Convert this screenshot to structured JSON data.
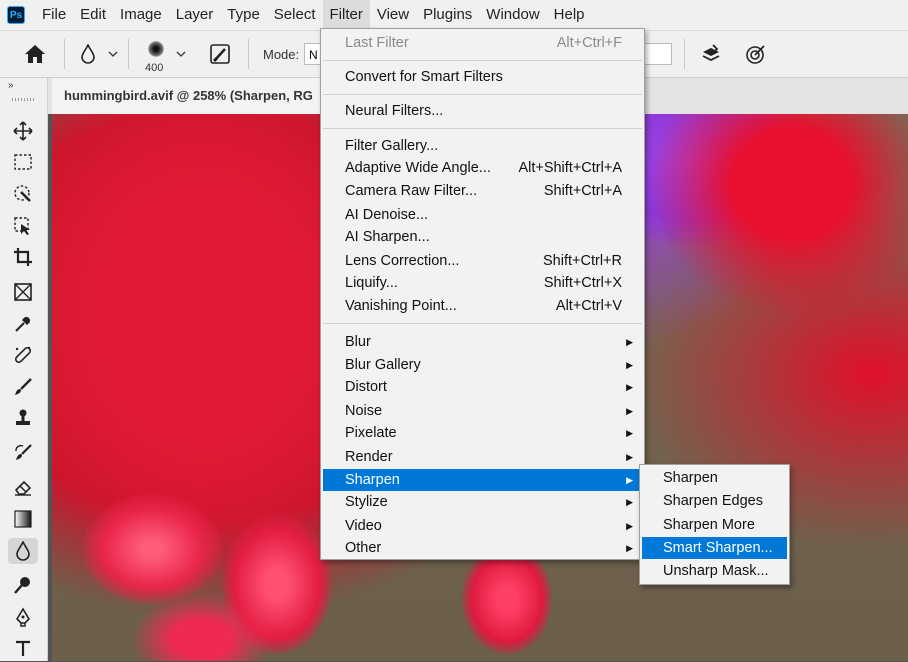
{
  "app": {
    "logo_text": "Ps"
  },
  "menubar": {
    "items": [
      "File",
      "Edit",
      "Image",
      "Layer",
      "Type",
      "Select",
      "Filter",
      "View",
      "Plugins",
      "Window",
      "Help"
    ],
    "active": "Filter"
  },
  "options": {
    "home_icon": "home-icon",
    "tool_icon": "blur-drop-icon",
    "brush_size": "400",
    "mode_label": "Mode:",
    "mode_value": "N"
  },
  "document": {
    "tab_title": "hummingbird.avif @ 258% (Sharpen, RG"
  },
  "filter_menu": {
    "items": [
      {
        "label": "Last Filter",
        "shortcut": "Alt+Ctrl+F",
        "disabled": true
      },
      {
        "label": "Convert for Smart Filters",
        "shortcut": ""
      },
      {
        "label": "Neural Filters...",
        "shortcut": ""
      },
      {
        "label": "Filter Gallery...",
        "shortcut": ""
      },
      {
        "label": "Adaptive Wide Angle...",
        "shortcut": "Alt+Shift+Ctrl+A"
      },
      {
        "label": "Camera Raw Filter...",
        "shortcut": "Shift+Ctrl+A"
      },
      {
        "label": "AI Denoise...",
        "shortcut": ""
      },
      {
        "label": "AI Sharpen...",
        "shortcut": ""
      },
      {
        "label": "Lens Correction...",
        "shortcut": "Shift+Ctrl+R"
      },
      {
        "label": "Liquify...",
        "shortcut": "Shift+Ctrl+X"
      },
      {
        "label": "Vanishing Point...",
        "shortcut": "Alt+Ctrl+V"
      },
      {
        "label": "Blur",
        "submenu": true
      },
      {
        "label": "Blur Gallery",
        "submenu": true
      },
      {
        "label": "Distort",
        "submenu": true
      },
      {
        "label": "Noise",
        "submenu": true
      },
      {
        "label": "Pixelate",
        "submenu": true
      },
      {
        "label": "Render",
        "submenu": true
      },
      {
        "label": "Sharpen",
        "submenu": true,
        "highlighted": true
      },
      {
        "label": "Stylize",
        "submenu": true
      },
      {
        "label": "Video",
        "submenu": true
      },
      {
        "label": "Other",
        "submenu": true
      }
    ]
  },
  "sharpen_submenu": {
    "items": [
      {
        "label": "Sharpen"
      },
      {
        "label": "Sharpen Edges"
      },
      {
        "label": "Sharpen More"
      },
      {
        "label": "Smart Sharpen...",
        "highlighted": true
      },
      {
        "label": "Unsharp Mask..."
      }
    ]
  },
  "colors": {
    "highlight": "#0078d7",
    "menu_bg": "#f2f2f2"
  }
}
